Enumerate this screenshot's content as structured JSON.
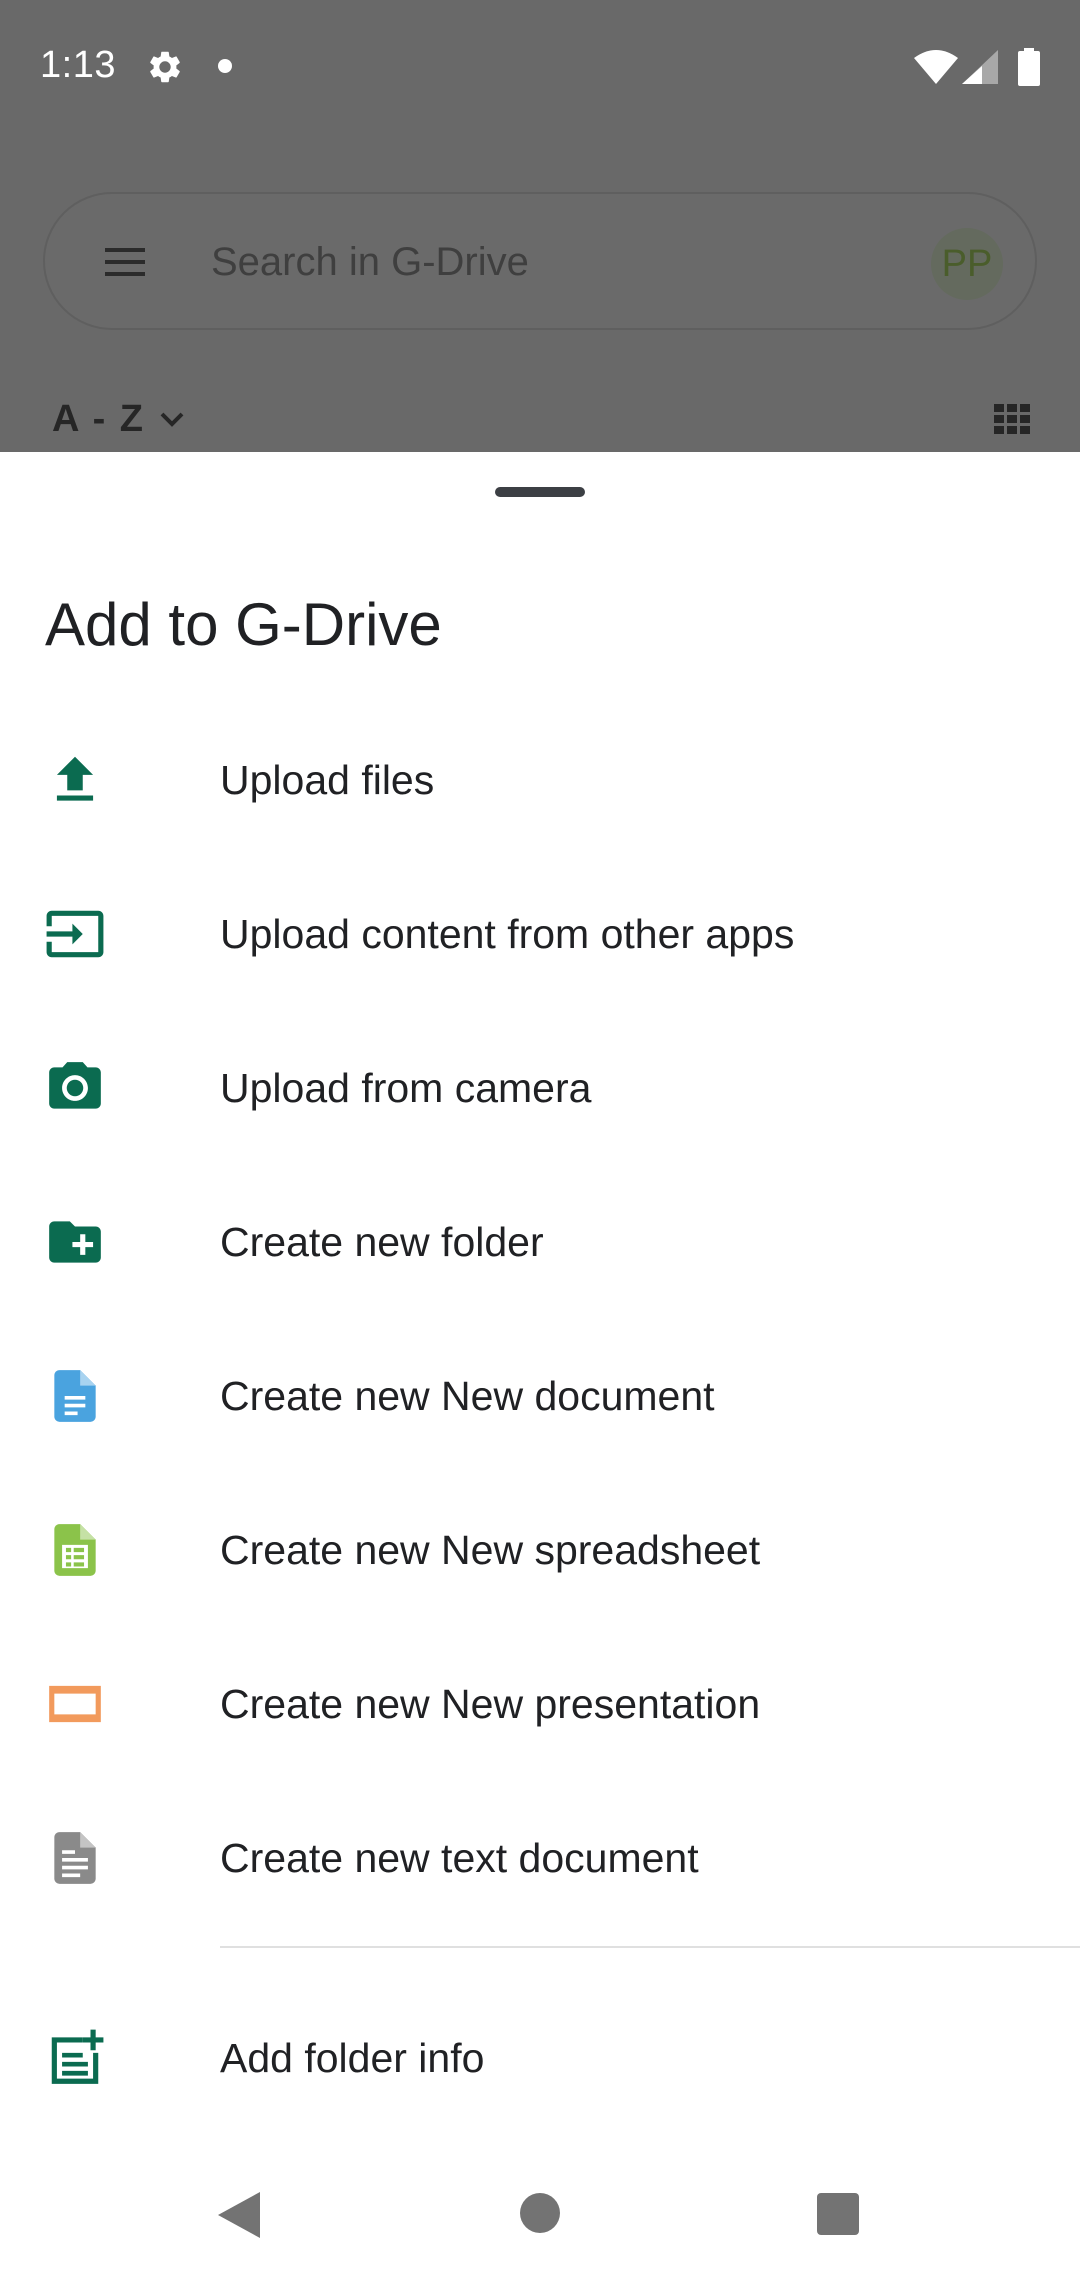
{
  "status_bar": {
    "time": "1:13"
  },
  "app": {
    "search_placeholder": "Search in G-Drive",
    "avatar_initials": "PP",
    "sort_label": "A - Z"
  },
  "sheet": {
    "title": "Add to G-Drive",
    "items": [
      {
        "label": "Upload files",
        "icon": "upload-icon",
        "color": "#0b6b50"
      },
      {
        "label": "Upload content from other apps",
        "icon": "input-icon",
        "color": "#0b6b50"
      },
      {
        "label": "Upload from camera",
        "icon": "camera-icon",
        "color": "#0b6b50"
      },
      {
        "label": "Create new folder",
        "icon": "new-folder-icon",
        "color": "#0b6b50"
      },
      {
        "label": "Create new New document",
        "icon": "document-icon",
        "color": "#4aa3df"
      },
      {
        "label": "Create new New spreadsheet",
        "icon": "spreadsheet-icon",
        "color": "#8bc34a"
      },
      {
        "label": "Create new New presentation",
        "icon": "presentation-icon",
        "color": "#f29a5c"
      },
      {
        "label": "Create new text document",
        "icon": "text-document-icon",
        "color": "#8a8a8a"
      },
      {
        "label": "Add folder info",
        "icon": "folder-info-icon",
        "color": "#0b6b50"
      }
    ]
  }
}
